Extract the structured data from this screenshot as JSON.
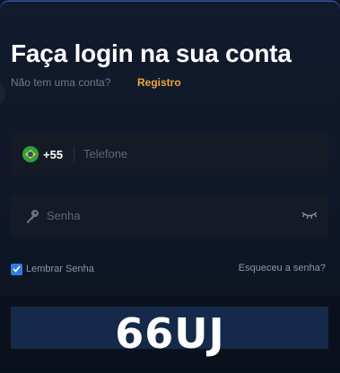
{
  "login": {
    "title": "Faça login na sua conta",
    "subtitle": "Não tem uma conta?",
    "register_link": "Registro"
  },
  "phone_field": {
    "country_flag": "brazil-flag-icon",
    "country_code": "+55",
    "placeholder": "Telefone"
  },
  "password_field": {
    "leading_icon": "key-icon",
    "placeholder": "Senha",
    "trailing_icon": "eye-closed-icon"
  },
  "remember": {
    "label": "Lembrar Senha",
    "checked": true
  },
  "forgot_link": "Esqueceu a senha?",
  "captcha": {
    "text": "66UJ"
  },
  "colors": {
    "accent_link": "#f0a63a",
    "checkbox": "#2f7ee0",
    "background": "#0e1524"
  }
}
